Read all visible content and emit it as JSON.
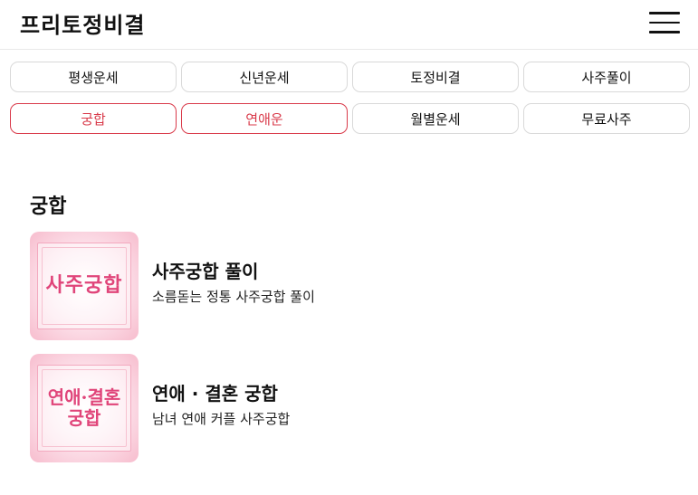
{
  "header": {
    "logo": "프리토정비결"
  },
  "nav": {
    "row1": [
      "평생운세",
      "신년운세",
      "토정비결",
      "사주풀이"
    ],
    "row2": [
      "궁합",
      "연애운",
      "월별운세",
      "무료사주"
    ]
  },
  "colors": {
    "accent": "#d93a4a",
    "thumb_text": "#e0457a"
  },
  "section": {
    "title": "궁합",
    "items": [
      {
        "thumb_text": [
          "사주궁합"
        ],
        "title": "사주궁합 풀이",
        "desc": "소름돋는 정통 사주궁합 풀이"
      },
      {
        "thumb_text": [
          "연애·결혼",
          "궁합"
        ],
        "title": "연애 · 결혼 궁합",
        "desc": "남녀 연애 커플 사주궁합"
      }
    ]
  }
}
